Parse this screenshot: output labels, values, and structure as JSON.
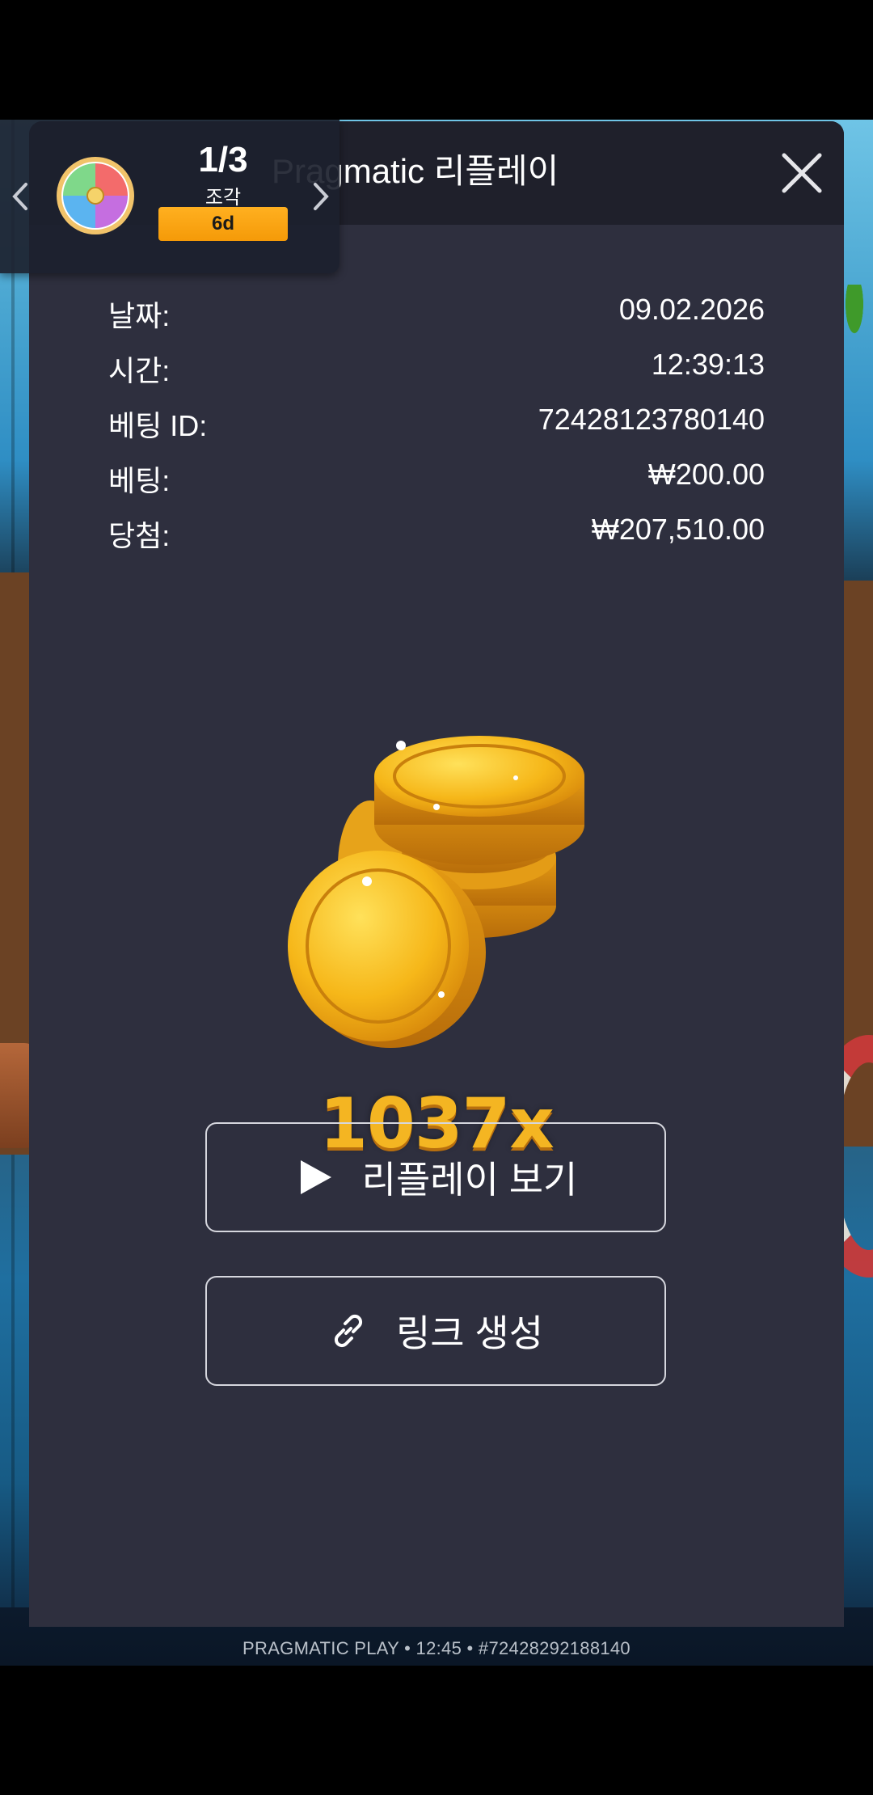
{
  "modal": {
    "title": "Pragmatic 리플레이",
    "close_icon": "close-icon"
  },
  "details": [
    {
      "label": "날짜:",
      "value": "09.02.2026"
    },
    {
      "label": "시간:",
      "value": "12:39:13"
    },
    {
      "label": "베팅 ID:",
      "value": "72428123780140"
    },
    {
      "label": "베팅:",
      "value": "₩200.00"
    },
    {
      "label": "당첨:",
      "value": "₩207,510.00"
    }
  ],
  "win": {
    "multiplier": "1037x",
    "illustration_icon": "gold-coins-icon"
  },
  "actions": {
    "replay_label": "리플레이 보기",
    "replay_icon": "play-icon",
    "link_label": "링크 생성",
    "link_icon": "link-icon"
  },
  "widget": {
    "count": "1/3",
    "subtitle": "조각",
    "badge": "6d",
    "wheel_icon": "prize-wheel-icon"
  },
  "footer": {
    "text": "PRAGMATIC PLAY • 12:45 • #72428292188140"
  },
  "colors": {
    "modal_bg": "#2e2f3e",
    "header_bg": "#1f202b",
    "accent_gold": "#f4b522",
    "badge_orange": "#f59a08"
  }
}
